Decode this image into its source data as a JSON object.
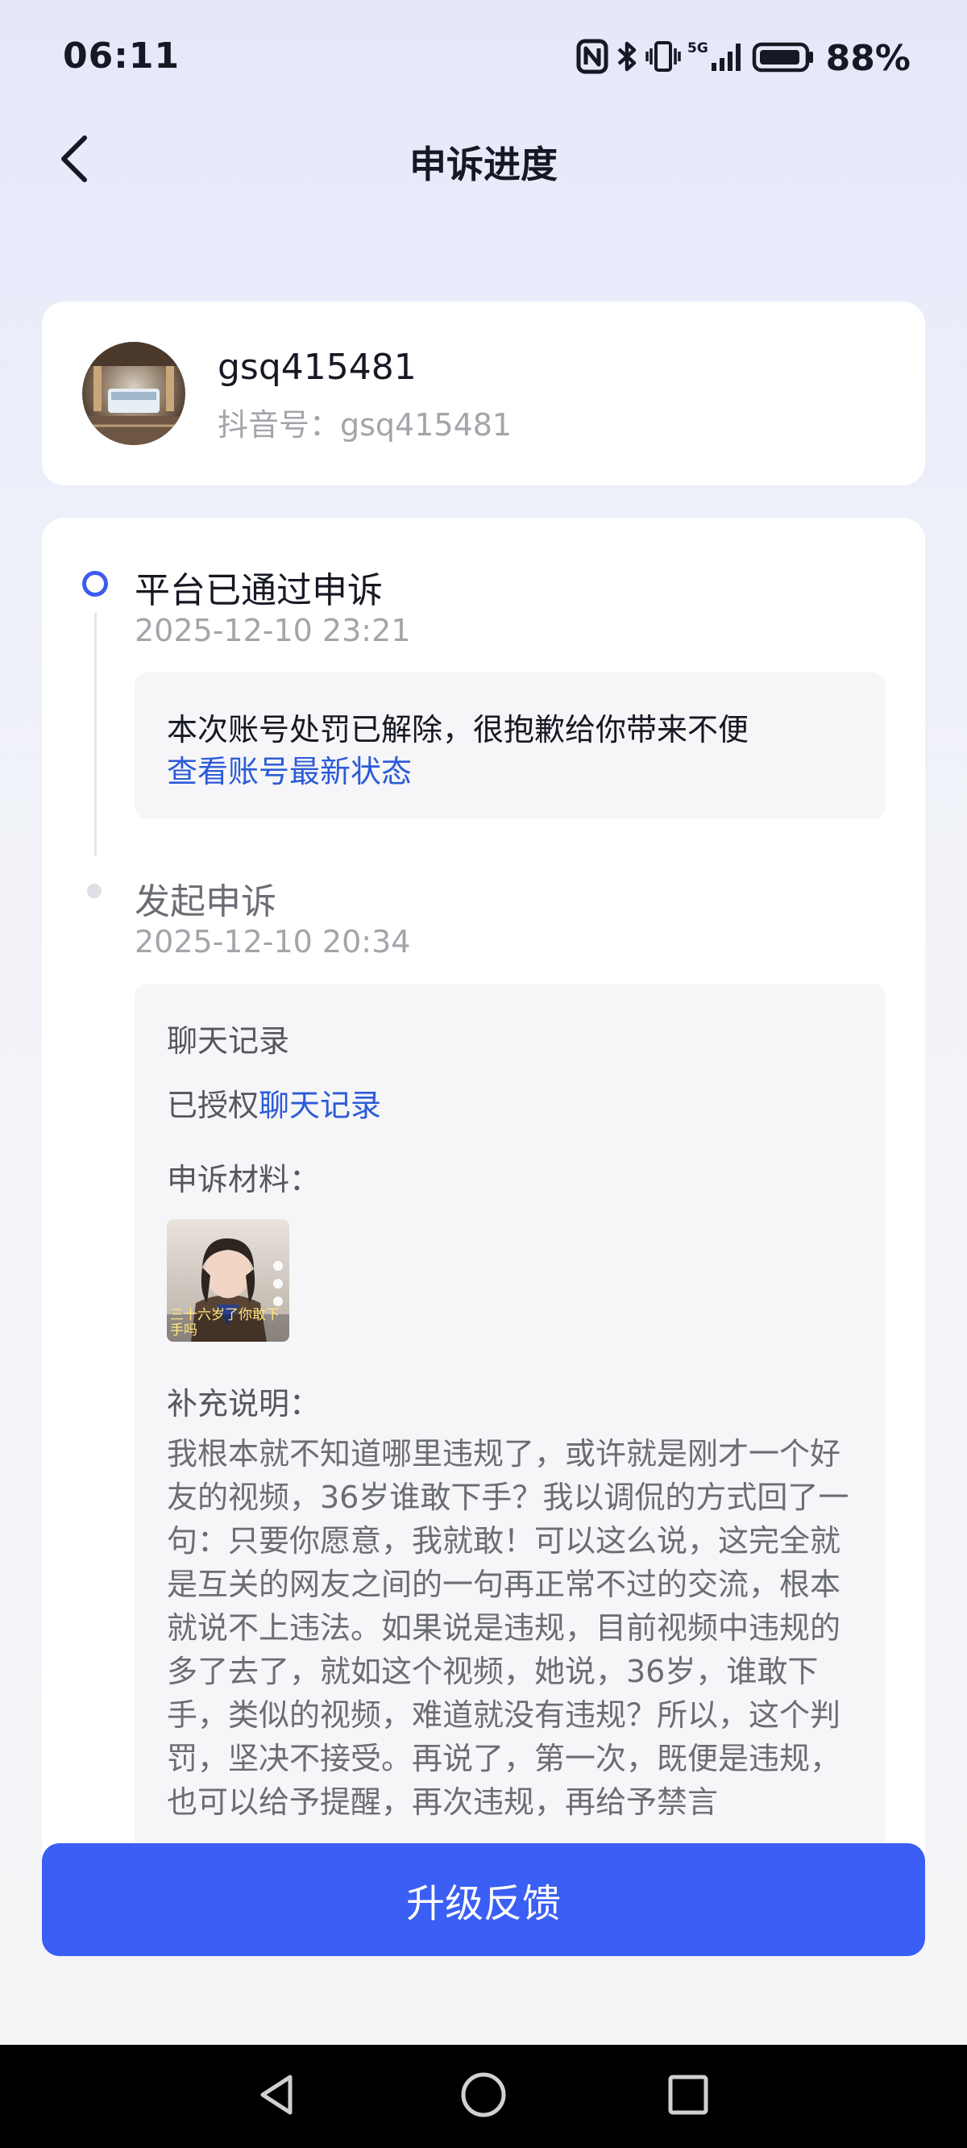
{
  "status_bar": {
    "time": "06:11",
    "icons": [
      "nfc-icon",
      "bluetooth-icon",
      "vibrate-icon",
      "5g-signal-icon",
      "battery-icon"
    ],
    "battery_percent": "88%",
    "battery_level": 0.88
  },
  "nav": {
    "title": "申诉进度",
    "back_icon": "chevron-left-icon"
  },
  "profile": {
    "username": "gsq415481",
    "douyin_id": "抖音号：gsq415481"
  },
  "timeline": [
    {
      "title": "平台已通过申诉",
      "time": "2025-12-10 23:21",
      "message": "本次账号处罚已解除，很抱歉给你带来不便",
      "link": "查看账号最新状态"
    },
    {
      "title": "发起申诉",
      "time": "2025-12-10 20:34",
      "chat_label": "聊天记录",
      "authorized_prefix": "已授权",
      "authorized_link": "聊天记录",
      "material_label": "申诉材料：",
      "thumbnail_caption": "三十六岁了你敢下手吗",
      "note_label": "补充说明：",
      "note_text": "我根本就不知道哪里违规了，或许就是刚才一个好友的视频，36岁谁敢下手？我以调侃的方式回了一句：只要你愿意，我就敢！可以这么说，这完全就是互关的网友之间的一句再正常不过的交流，根本就说不上违法。如果说是违规，目前视频中违规的多了去了，就如这个视频，她说，36岁，谁敢下手，类似的视频，难道就没有违规？所以，这个判罚，坚决不接受。再说了，第一次，既便是违规，也可以给予提醒，再次违规，再给予禁言"
    }
  ],
  "colors": {
    "accent": "#3b5ff4",
    "link": "#2c5bd8",
    "background_top": "#e4e8fa",
    "card": "#ffffff"
  },
  "bottom_button": {
    "label": "升级反馈"
  },
  "system_nav": {
    "icons": [
      "back-triangle-icon",
      "home-circle-icon",
      "recents-square-icon"
    ]
  }
}
